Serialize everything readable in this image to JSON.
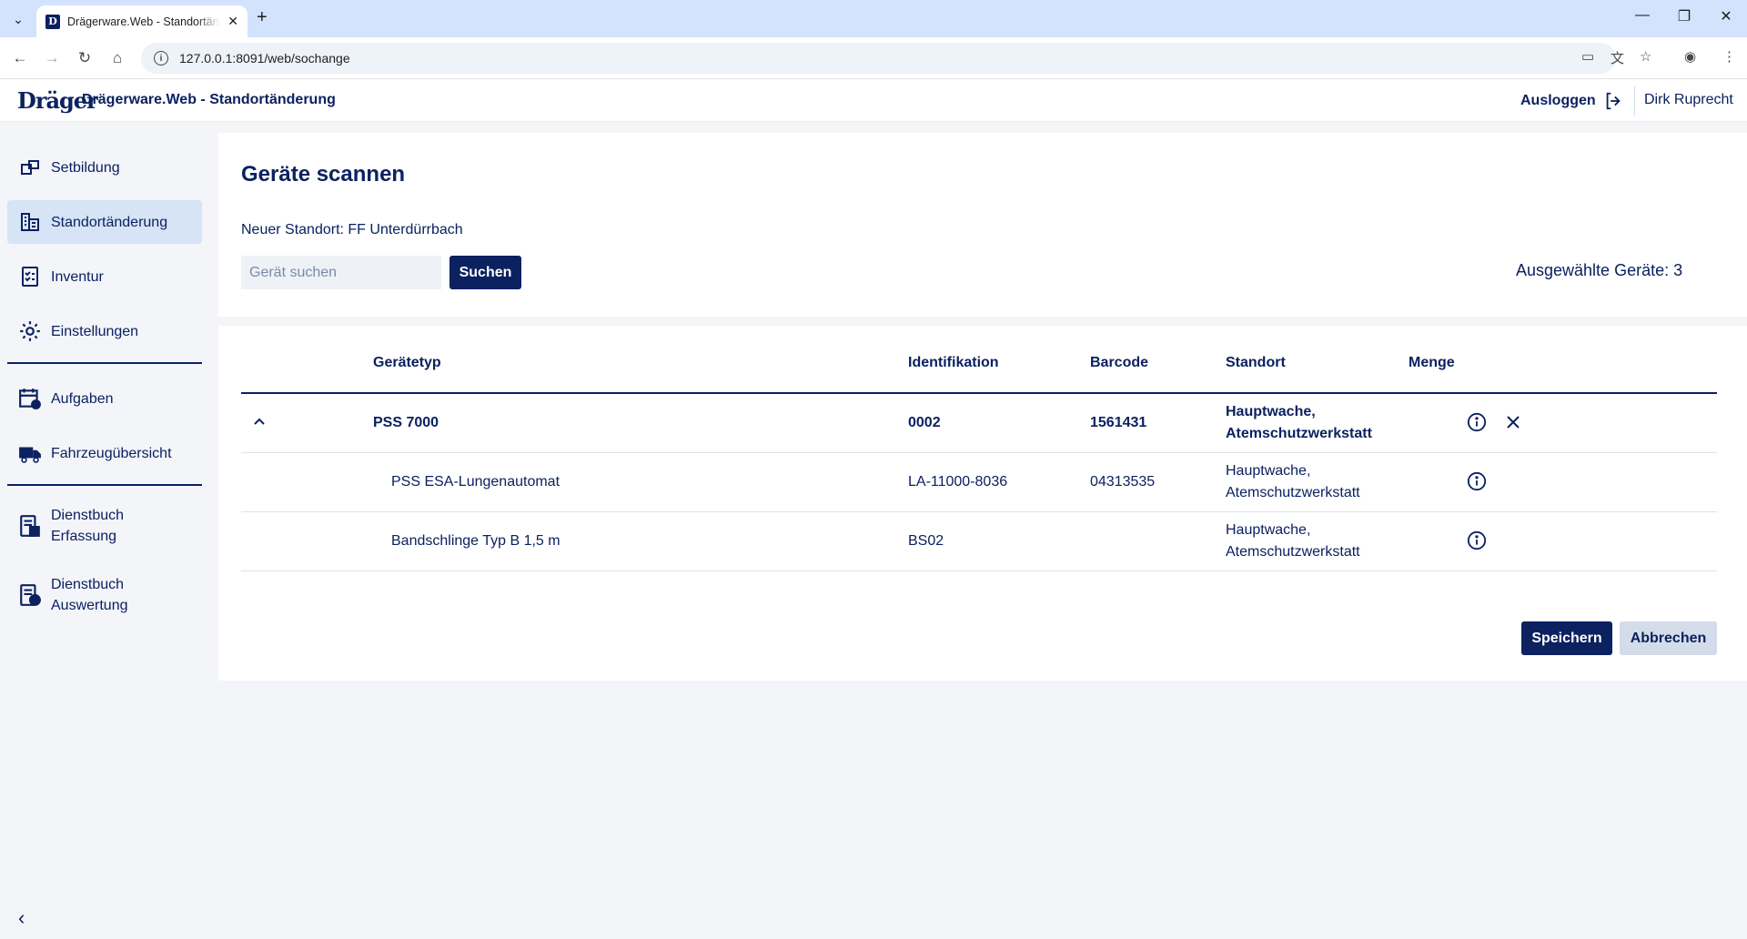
{
  "browser": {
    "tab_title": "Drägerware.Web - Standortänderung",
    "favicon_letter": "D",
    "url": "127.0.0.1:8091/web/sochange"
  },
  "header": {
    "logo": "Dräger",
    "title": "Drägerware.Web - Standortänderung",
    "logout_label": "Ausloggen",
    "user_name": "Dirk Ruprecht"
  },
  "sidebar": {
    "items": [
      {
        "label": "Setbildung",
        "icon": "set-icon"
      },
      {
        "label": "Standortänderung",
        "icon": "building-icon",
        "active": true
      },
      {
        "label": "Inventur",
        "icon": "checklist-icon"
      },
      {
        "label": "Einstellungen",
        "icon": "gear-icon"
      },
      {
        "label": "Aufgaben",
        "icon": "calendar-icon"
      },
      {
        "label": "Fahrzeugübersicht",
        "icon": "truck-icon"
      },
      {
        "label": "Dienstbuch Erfassung",
        "icon": "logbook-edit-icon"
      },
      {
        "label": "Dienstbuch Auswertung",
        "icon": "logbook-check-icon"
      }
    ]
  },
  "main": {
    "title": "Geräte scannen",
    "new_location": "Neuer Standort: FF Unterdürrbach",
    "search_placeholder": "Gerät suchen",
    "search_button": "Suchen",
    "selected_count": "Ausgewählte Geräte: 3",
    "table": {
      "headers": [
        "Gerätetyp",
        "Identifikation",
        "Barcode",
        "Standort",
        "Menge"
      ],
      "rows": [
        {
          "type": "PSS 7000",
          "id": "0002",
          "barcode": "1561431",
          "location_line1": "Hauptwache,",
          "location_line2": "Atemschutzwerkstatt",
          "parent": true
        },
        {
          "type": "PSS ESA-Lungenautomat",
          "id": "LA-11000-8036",
          "barcode": "04313535",
          "location_line1": "Hauptwache,",
          "location_line2": "Atemschutzwerkstatt"
        },
        {
          "type": "Bandschlinge Typ B 1,5 m",
          "id": "BS02",
          "barcode": "",
          "location_line1": "Hauptwache,",
          "location_line2": "Atemschutzwerkstatt"
        }
      ]
    },
    "save_button": "Speichern",
    "cancel_button": "Abbrechen"
  },
  "colors": {
    "brand_navy": "#0b2160",
    "active_nav": "#d6e4f5",
    "page_bg": "#f3f5f9"
  }
}
